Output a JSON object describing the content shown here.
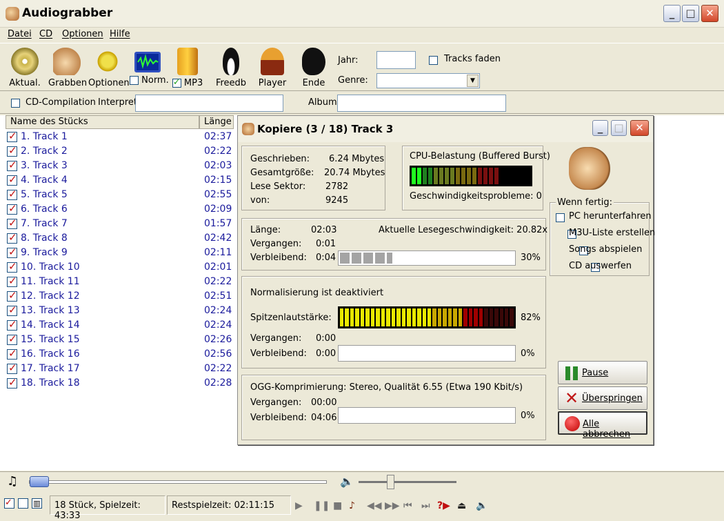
{
  "app": {
    "title": "Audiograbber"
  },
  "menu": [
    "Datei",
    "CD",
    "Optionen",
    "Hilfe"
  ],
  "toolbar": {
    "buttons": [
      {
        "label": "Aktual.",
        "icon": "cd-refresh-icon"
      },
      {
        "label": "Grabben",
        "icon": "hand-grab-icon"
      },
      {
        "label": "Optionen",
        "icon": "gear-options-icon"
      },
      {
        "label": "Norm.",
        "icon": "monitor-waveform-icon",
        "checked": false
      },
      {
        "label": "MP3",
        "icon": "clamp-mp3-icon",
        "checked": true
      },
      {
        "label": "Freedb",
        "icon": "penguin-icon"
      },
      {
        "label": "Player",
        "icon": "gramophone-icon"
      },
      {
        "label": "Ende",
        "icon": "exit-splat-icon"
      }
    ],
    "jahr_label": "Jahr:",
    "jahr_value": "",
    "genre_label": "Genre:",
    "genre_value": "",
    "tracks_faden_label": "Tracks faden"
  },
  "row2": {
    "compilation_label": "CD-Compilation",
    "interpret_label": "Interpret",
    "interpret_value": "",
    "album_label": "Album",
    "album_value": ""
  },
  "list": {
    "headers": [
      "Name des Stücks",
      "Länge"
    ],
    "tracks": [
      {
        "name": "1. Track  1",
        "len": "02:37"
      },
      {
        "name": "2. Track  2",
        "len": "02:22"
      },
      {
        "name": "3. Track  3",
        "len": "02:03"
      },
      {
        "name": "4. Track  4",
        "len": "02:15"
      },
      {
        "name": "5. Track  5",
        "len": "02:55"
      },
      {
        "name": "6. Track  6",
        "len": "02:09"
      },
      {
        "name": "7. Track  7",
        "len": "01:57"
      },
      {
        "name": "8. Track  8",
        "len": "02:42"
      },
      {
        "name": "9. Track  9",
        "len": "02:11"
      },
      {
        "name": "10. Track 10",
        "len": "02:01"
      },
      {
        "name": "11. Track 11",
        "len": "02:22"
      },
      {
        "name": "12. Track 12",
        "len": "02:51"
      },
      {
        "name": "13. Track 13",
        "len": "02:24"
      },
      {
        "name": "14. Track 14",
        "len": "02:24"
      },
      {
        "name": "15. Track 15",
        "len": "02:26"
      },
      {
        "name": "16. Track 16",
        "len": "02:56"
      },
      {
        "name": "17. Track 17",
        "len": "02:22"
      },
      {
        "name": "18. Track 18",
        "len": "02:28"
      }
    ]
  },
  "dialog": {
    "title": "Kopiere  (3 / 18)   Track  3",
    "stats": {
      "geschrieben_label": "Geschrieben:",
      "geschrieben": "6.24 Mbytes",
      "gesamt_label": "Gesamtgröße:",
      "gesamt": "20.74 Mbytes",
      "sektor_label": "Lese Sektor:",
      "sektor": "2782",
      "von_label": "von:",
      "von": "9245"
    },
    "cpu": {
      "label": "CPU-Belastung (Buffered Burst)",
      "problems": "Geschwindigkeitsprobleme: 0"
    },
    "wenn_fertig": {
      "label": "Wenn fertig:",
      "options": [
        "PC herunterfahren",
        "M3U-Liste erstellen",
        "Songs abspielen",
        "CD auswerfen"
      ]
    },
    "read": {
      "laenge_label": "Länge:",
      "laenge": "02:03",
      "speed": "Aktuelle Lesegeschwindigkeit: 20.82x",
      "vergangen_label": "Vergangen:",
      "vergangen": "0:01",
      "verbleibend_label": "Verbleibend:",
      "verbleibend": "0:04",
      "percent": "30%",
      "progress": 0.3
    },
    "norm": {
      "status": "Normalisierung ist deaktiviert",
      "spitzen_label": "Spitzenlautstärke:",
      "spitzen_percent": "82%",
      "vergangen_label": "Vergangen:",
      "vergangen": "0:00",
      "verbleibend_label": "Verbleibend:",
      "verbleibend": "0:00",
      "percent": "0%"
    },
    "ogg": {
      "status": "OGG-Komprimierung: Stereo, Qualität 6.55 (Etwa 190 Kbit/s)",
      "vergangen_label": "Vergangen:",
      "vergangen": "00:00",
      "verbleibend_label": "Verbleibend:",
      "verbleibend": "04:06",
      "percent": "0%"
    },
    "buttons": {
      "pause": "Pause",
      "skip": "Überspringen",
      "abort": "Alle abbrechen"
    }
  },
  "status": {
    "count": "18 Stück,  Spielzeit: 43:33",
    "rest": "Restspielzeit: 02:11:15"
  }
}
